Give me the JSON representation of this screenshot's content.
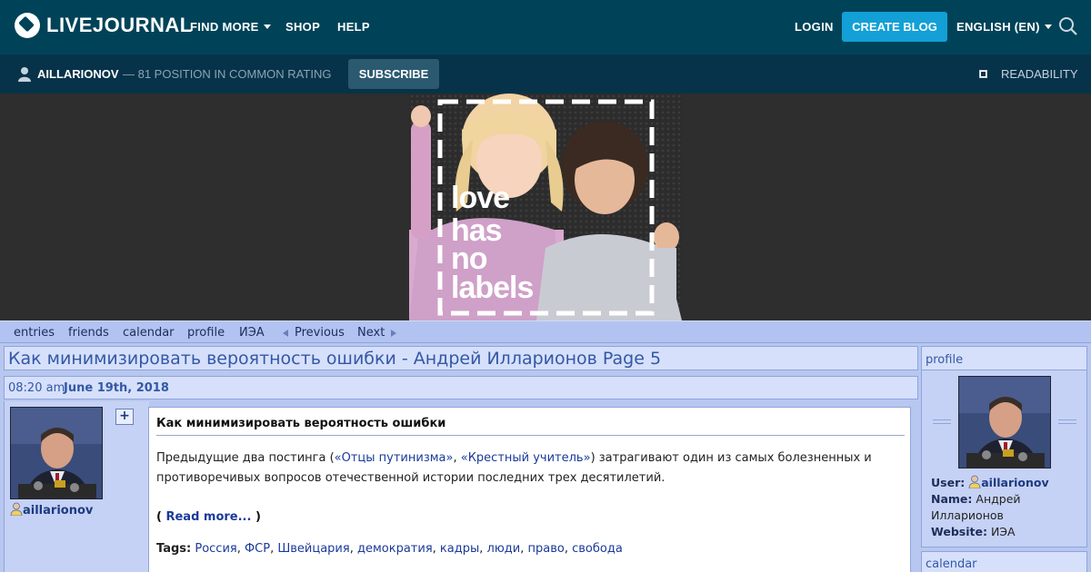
{
  "topbar": {
    "logo_text": "LIVEJOURNAL",
    "nav": {
      "find_more": "FIND MORE",
      "shop": "SHOP",
      "help": "HELP"
    },
    "login": "LOGIN",
    "create_blog": "CREATE BLOG",
    "language": "ENGLISH (EN)",
    "colors": {
      "background": "#004359",
      "accent": "#13a0d6"
    }
  },
  "subbar": {
    "username": "AILLARIONOV",
    "rating": "— 81 POSITION IN COMMON RATING",
    "subscribe": "SUBSCRIBE",
    "readability": "READABILITY"
  },
  "banner": {
    "text_lines": [
      "love",
      "has",
      "no",
      "labels"
    ]
  },
  "journal_nav": {
    "entries": "entries",
    "friends": "friends",
    "calendar": "calendar",
    "profile": "profile",
    "iea": "ИЭА",
    "previous": "Previous",
    "next": "Next"
  },
  "entry": {
    "page_title": "Как минимизировать вероятность ошибки - Андрей Илларионов Page 5",
    "time": "08:20 am",
    "date": "June 19th, 2018",
    "poster": "aillarionov",
    "plus": "+",
    "title": "Как минимизировать вероятность ошибки",
    "text_prefix": "Предыдущие два постинга (",
    "link1": "«Отцы путинизма»",
    "text_sep": ", ",
    "link2": "«Крестный учитель»",
    "text_suffix": ") затрагивают один из самых болезненных и противоречивых вопросов отечественной истории последних трех десятилетий.",
    "read_more_open": "( ",
    "read_more": "Read more...",
    "read_more_close": " )",
    "tags_label": "Tags:",
    "tags": [
      "Россия",
      "ФСР",
      "Швейцария",
      "демократия",
      "кадры",
      "люди",
      "право",
      "свобода"
    ]
  },
  "sidebar": {
    "profile_heading": "profile",
    "user_label": "User:",
    "user_value": "aillarionov",
    "name_label": "Name:",
    "name_value": "Андрей Илларионов",
    "website_label": "Website:",
    "website_value": "ИЭА",
    "calendar_heading": "calendar"
  }
}
